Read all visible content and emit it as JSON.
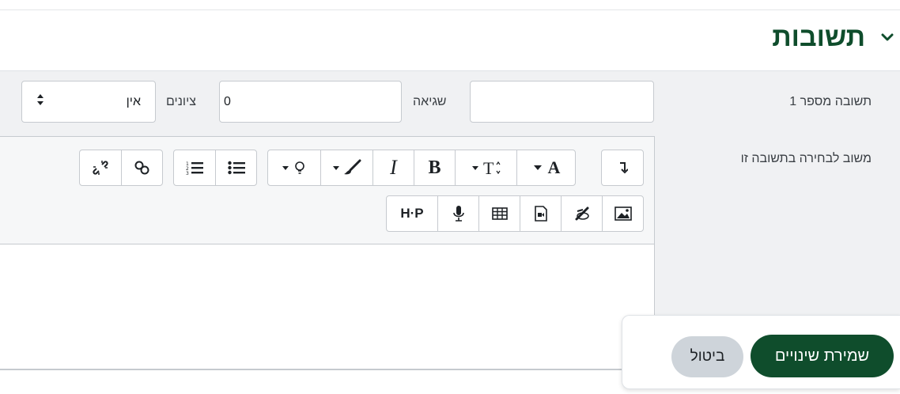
{
  "section": {
    "title": "תשובות",
    "icon": "chevron-down-icon",
    "accent_color": "#0f4d2c"
  },
  "answer_row": {
    "label": "תשובה מספר 1",
    "answer_value": "",
    "error_label": "שגיאה",
    "error_value": "0",
    "grade_label": "ציונים",
    "grade_value": "אין"
  },
  "feedback_row": {
    "label": "משוב לבחירה בתשובה זו"
  },
  "toolbar": {
    "row1": [
      {
        "name": "rtl-direction",
        "icon": "direction-icon"
      },
      {
        "name": "font-color",
        "icon": "font-color-icon",
        "text": "A"
      },
      {
        "name": "font-size",
        "icon": "font-size-icon"
      },
      {
        "name": "bold",
        "icon": "bold-icon",
        "text": "B"
      },
      {
        "name": "italic",
        "icon": "italic-icon",
        "text": "I"
      },
      {
        "name": "background-color",
        "icon": "paintbrush-icon"
      },
      {
        "name": "idea",
        "icon": "lightbulb-icon"
      },
      {
        "name": "unordered-list",
        "icon": "bullet-list-icon"
      },
      {
        "name": "ordered-list",
        "icon": "numbered-list-icon"
      },
      {
        "name": "link",
        "icon": "link-icon"
      },
      {
        "name": "unlink",
        "icon": "unlink-icon"
      }
    ],
    "row2": [
      {
        "name": "image",
        "icon": "image-icon"
      },
      {
        "name": "drawing",
        "icon": "brush-drawing-icon"
      },
      {
        "name": "media",
        "icon": "media-file-icon"
      },
      {
        "name": "table",
        "icon": "table-icon"
      },
      {
        "name": "record-audio",
        "icon": "microphone-icon"
      },
      {
        "name": "h5p",
        "icon": "h5p-icon",
        "text": "H·P"
      }
    ]
  },
  "footer": {
    "save_label": "שמירת שינויים",
    "cancel_label": "ביטול"
  }
}
